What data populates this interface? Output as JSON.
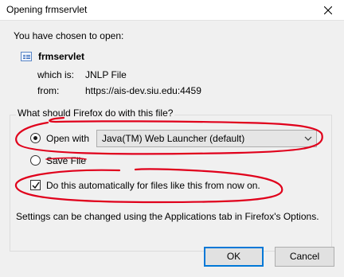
{
  "window": {
    "title": "Opening frmservlet"
  },
  "dialog": {
    "intro": "You have chosen to open:",
    "file_name": "frmservlet",
    "which_is_label": "which is:",
    "which_is_value": "JNLP File",
    "from_label": "from:",
    "from_value": "https://ais-dev.siu.edu:4459",
    "group_label": "What should Firefox do with this file?",
    "open_with_label": "Open with",
    "open_with_selected": "Java(TM) Web Launcher (default)",
    "save_file_label": "Save File",
    "auto_label": "Do this automatically for files like this from now on.",
    "settings_note": "Settings can be changed using the Applications tab in Firefox's Options.",
    "ok_label": "OK",
    "cancel_label": "Cancel"
  },
  "state": {
    "open_with_checked": true,
    "save_file_checked": false,
    "auto_checked": true
  },
  "colors": {
    "annotation": "#e0001b",
    "accent": "#0078d7"
  }
}
